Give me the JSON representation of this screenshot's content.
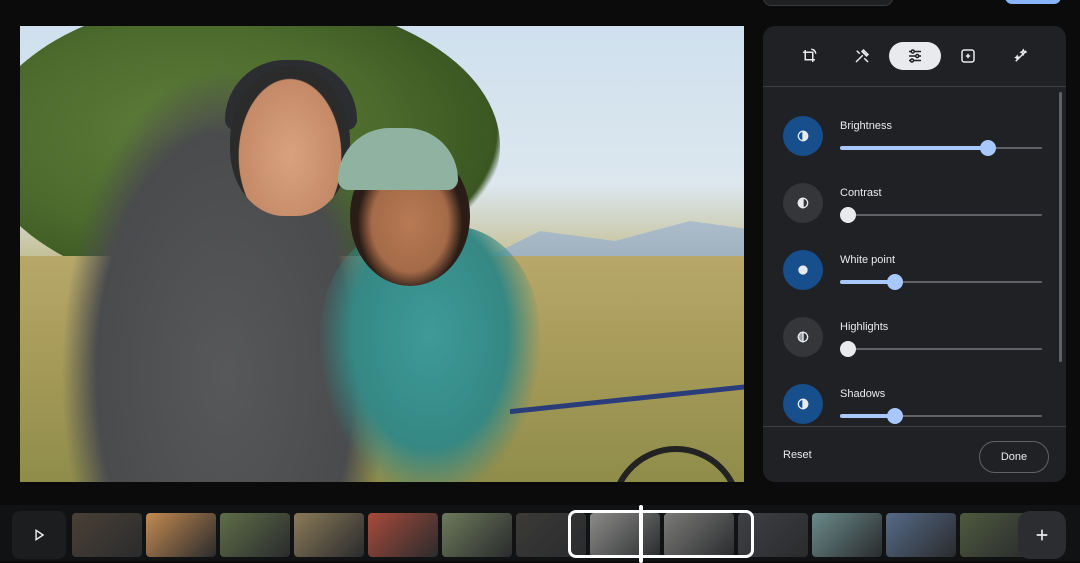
{
  "editor": {
    "tools": [
      {
        "name": "crop-rotate",
        "icon": "crop-rotate-icon",
        "active": false
      },
      {
        "name": "tools",
        "icon": "tools-icon",
        "active": false
      },
      {
        "name": "adjust",
        "icon": "sliders-icon",
        "active": true
      },
      {
        "name": "filters",
        "icon": "filter-icon",
        "active": false
      },
      {
        "name": "effects",
        "icon": "sparkle-icon",
        "active": false
      }
    ],
    "adjustments": [
      {
        "label": "Brightness",
        "value": 0.75,
        "active": true
      },
      {
        "label": "Contrast",
        "value": 0.0,
        "active": false
      },
      {
        "label": "White point",
        "value": 0.25,
        "active": true
      },
      {
        "label": "Highlights",
        "value": 0.0,
        "active": false
      },
      {
        "label": "Shadows",
        "value": 0.25,
        "active": true
      }
    ],
    "reset_label": "Reset",
    "done_label": "Done"
  },
  "colors": {
    "accent": "#a8c7fa",
    "active_icon_bg": "#164f8c",
    "panel_bg": "#202124"
  },
  "filmstrip": {
    "play_icon": "play-icon",
    "add_icon": "plus-icon",
    "thumbnails": [
      {
        "color": "#4a4035"
      },
      {
        "color": "#c48a50"
      },
      {
        "color": "#5e6e48"
      },
      {
        "color": "#8a7a58"
      },
      {
        "color": "#a84a3a"
      },
      {
        "color": "#6c7a5a"
      },
      {
        "color": "#3b3a38"
      },
      {
        "color": "#8c8d8a"
      },
      {
        "color": "#7a7b78"
      },
      {
        "color": "#3f4044"
      },
      {
        "color": "#6a8a8a"
      },
      {
        "color": "#556a88"
      },
      {
        "color": "#4e5a3e"
      }
    ]
  }
}
